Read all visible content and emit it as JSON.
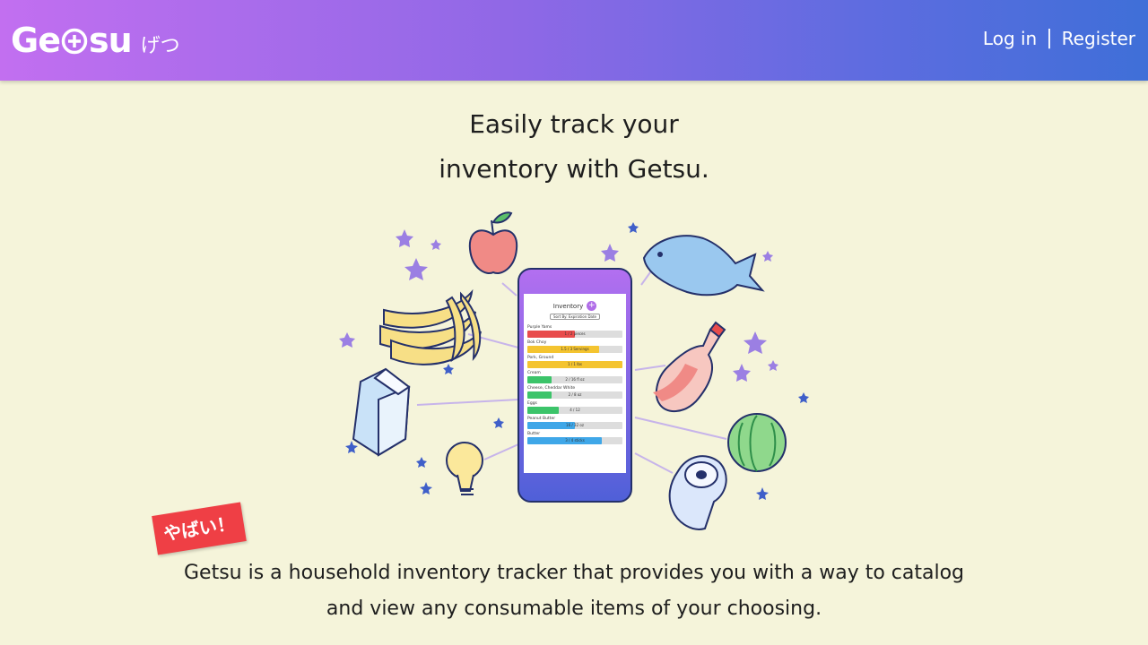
{
  "brand": {
    "name_part1": "Ge",
    "name_part2": "su",
    "subtitle_jp": "げつ",
    "colors": {
      "gradient_start": "#c26ff0",
      "gradient_end": "#3f6fd8"
    }
  },
  "nav": {
    "login": "Log in",
    "separator": "|",
    "register": "Register"
  },
  "hero": {
    "line1": "Easily track your",
    "line2": "inventory with Getsu."
  },
  "phone": {
    "title": "Inventory",
    "sort_label": "Sort By: Expiration Date",
    "items": [
      {
        "name": "Purple Yams",
        "amount": "1 / 2 pieces",
        "fill": 0.5,
        "color": "#e84c4c"
      },
      {
        "name": "Bok Choy",
        "amount": "1.5 / 3 Servings",
        "fill": 0.75,
        "color": "#f4c430"
      },
      {
        "name": "Pork, Ground",
        "amount": "1 / 1 lbs",
        "fill": 1.0,
        "color": "#f4c430"
      },
      {
        "name": "Cream",
        "amount": "2 / 16 fl oz",
        "fill": 0.25,
        "color": "#3cc46a"
      },
      {
        "name": "Cheese, Cheddar White",
        "amount": "2 / 8 oz",
        "fill": 0.25,
        "color": "#3cc46a"
      },
      {
        "name": "Eggs",
        "amount": "4 / 12",
        "fill": 0.33,
        "color": "#3cc46a"
      },
      {
        "name": "Peanut Butter",
        "amount": "16 / 32 oz",
        "fill": 0.5,
        "color": "#3fa7e8"
      },
      {
        "name": "Butter",
        "amount": "3 / 4 sticks",
        "fill": 0.78,
        "color": "#3fa7e8"
      }
    ]
  },
  "badge": {
    "text": "やばい！"
  },
  "description": {
    "line1": "Getsu is a household inventory tracker that provides you with a way to catalog",
    "line2": "and view any consumable items of your choosing."
  }
}
